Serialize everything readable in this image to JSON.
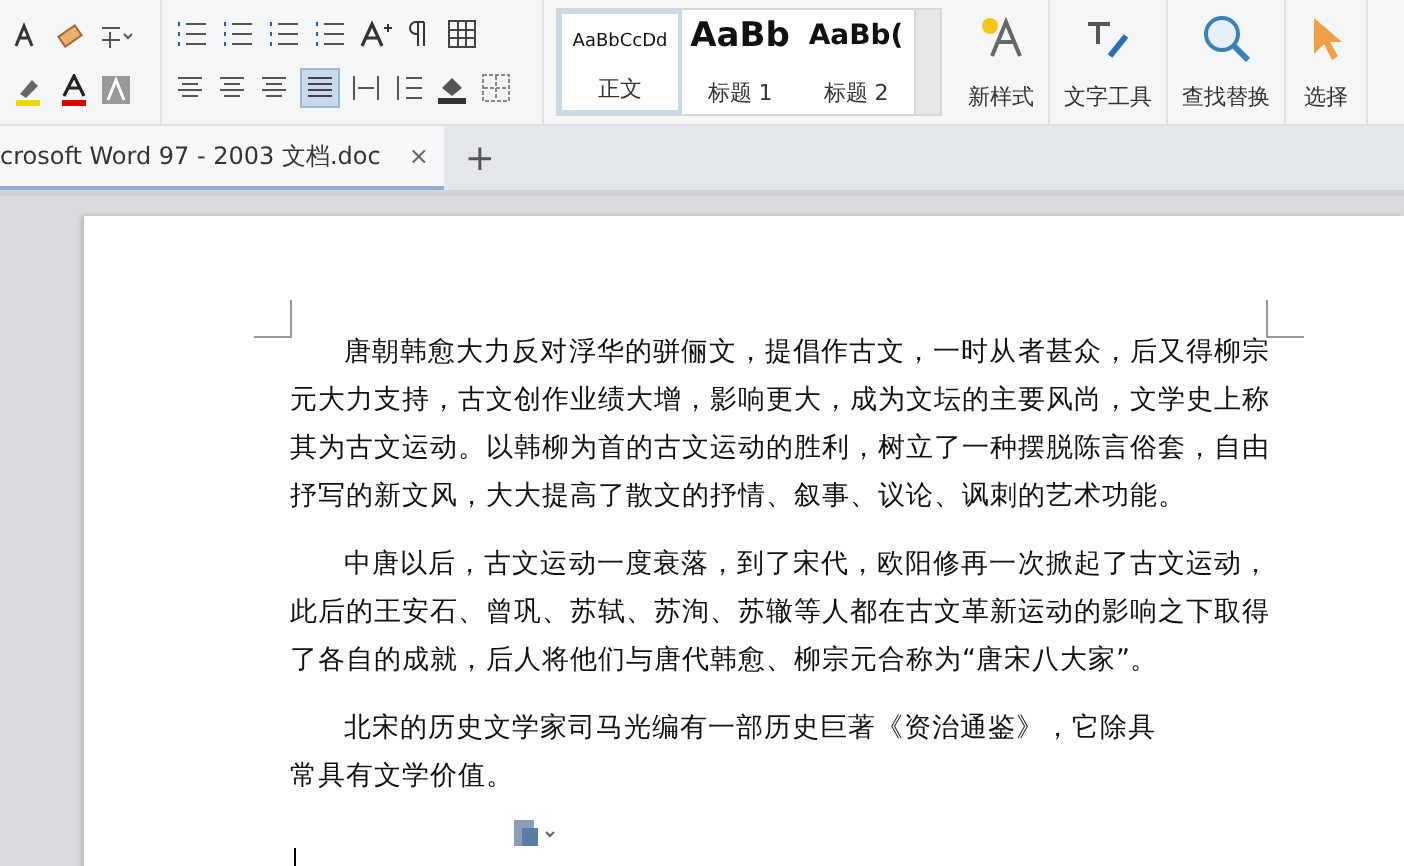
{
  "ribbon": {
    "styles": [
      {
        "preview": "AaBbCcDd",
        "label": "正文",
        "kind": "normal",
        "selected": true
      },
      {
        "preview": "AaBb",
        "label": "标题 1",
        "kind": "heading1",
        "selected": false
      },
      {
        "preview": "AaBb(",
        "label": "标题 2",
        "kind": "heading2",
        "selected": false
      }
    ],
    "big_buttons": [
      {
        "label": "新样式",
        "kind": "newstyle"
      },
      {
        "label": "文字工具",
        "kind": "texttools"
      },
      {
        "label": "查找替换",
        "kind": "find"
      },
      {
        "label": "选择",
        "kind": "select"
      }
    ]
  },
  "tabs": [
    {
      "label": "crosoft Word 97 - 2003 文档.doc",
      "close": "×",
      "selected": true
    }
  ],
  "new_tab": "+",
  "document": {
    "paragraphs": [
      "唐朝韩愈大力反对浮华的骈俪文，提倡作古文，一时从者甚众，后又得柳宗元大力支持，古文创作业绩大增，影响更大，成为文坛的主要风尚，文学史上称其为古文运动。以韩柳为首的古文运动的胜利，树立了一种摆脱陈言俗套，自由抒写的新文风，大大提高了散文的抒情、叙事、议论、讽刺的艺术功能。",
      "中唐以后，古文运动一度衰落，到了宋代，欧阳修再一次掀起了古文运动，此后的王安石、曾巩、苏轼、苏洵、苏辙等人都在古文革新运动的影响之下取得了各自的成就，后人将他们与唐代韩愈、柳宗元合称为“唐宋八大家”。",
      "北宋的历史文学家司马光编有一部历史巨著《资治通鉴》，它除具",
      "常具有文学价值。"
    ]
  }
}
